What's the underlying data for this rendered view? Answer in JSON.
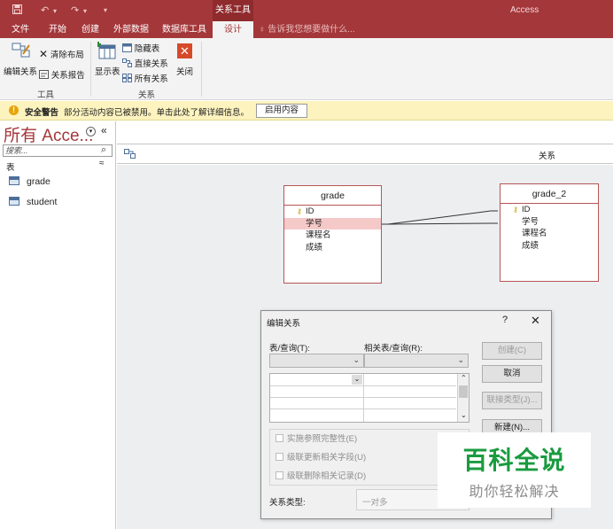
{
  "titlebar": {
    "save_icon": "save-icon",
    "undo_icon": "undo-icon",
    "redo_icon": "redo-icon",
    "context_tab_group": "关系工具",
    "app_title": "Access"
  },
  "tabs": [
    {
      "label": "文件"
    },
    {
      "label": "开始"
    },
    {
      "label": "创建"
    },
    {
      "label": "外部数据"
    },
    {
      "label": "数据库工具"
    },
    {
      "label": "设计"
    }
  ],
  "tell_me": "告诉我您想要做什么...",
  "ribbon": {
    "tools_group": {
      "label": "工具",
      "edit_relationships": "编辑关系",
      "clear_layout": "清除布局",
      "relationship_report": "关系报告"
    },
    "relationships_group": {
      "label": "关系",
      "show_table": "显示表",
      "hide_table": "隐藏表",
      "direct_relationships": "直接关系",
      "all_relationships": "所有关系",
      "close": "关闭"
    }
  },
  "security_bar": {
    "title": "安全警告",
    "message": "部分活动内容已被禁用。单击此处了解详细信息。",
    "enable_button": "启用内容"
  },
  "nav_pane": {
    "title": "所有 Acce...",
    "search_placeholder": "搜索...",
    "section": "表",
    "items": [
      {
        "label": "grade"
      },
      {
        "label": "student"
      }
    ]
  },
  "document": {
    "tab_label": "关系"
  },
  "tables": [
    {
      "name": "grade",
      "fields": [
        "ID",
        "学号",
        "课程名",
        "成绩"
      ],
      "key_field": "ID",
      "selected_field": "学号"
    },
    {
      "name": "grade_2",
      "fields": [
        "ID",
        "学号",
        "课程名",
        "成绩"
      ],
      "key_field": "ID"
    }
  ],
  "dialog": {
    "title": "编辑关系",
    "help": "?",
    "close": "✕",
    "table_query_label": "表/查询(T):",
    "related_table_label": "相关表/查询(R):",
    "create_button": "创建(C)",
    "cancel_button": "取消",
    "join_type_button": "联接类型(J)...",
    "new_button": "新建(N)...",
    "enforce_integrity": "实施参照完整性(E)",
    "cascade_update": "级联更新相关字段(U)",
    "cascade_delete": "级联删除相关记录(D)",
    "relationship_type_label": "关系类型:",
    "relationship_type_value": "一对多"
  },
  "watermark": {
    "main": "百科全说",
    "sub": "助你轻松解决"
  }
}
